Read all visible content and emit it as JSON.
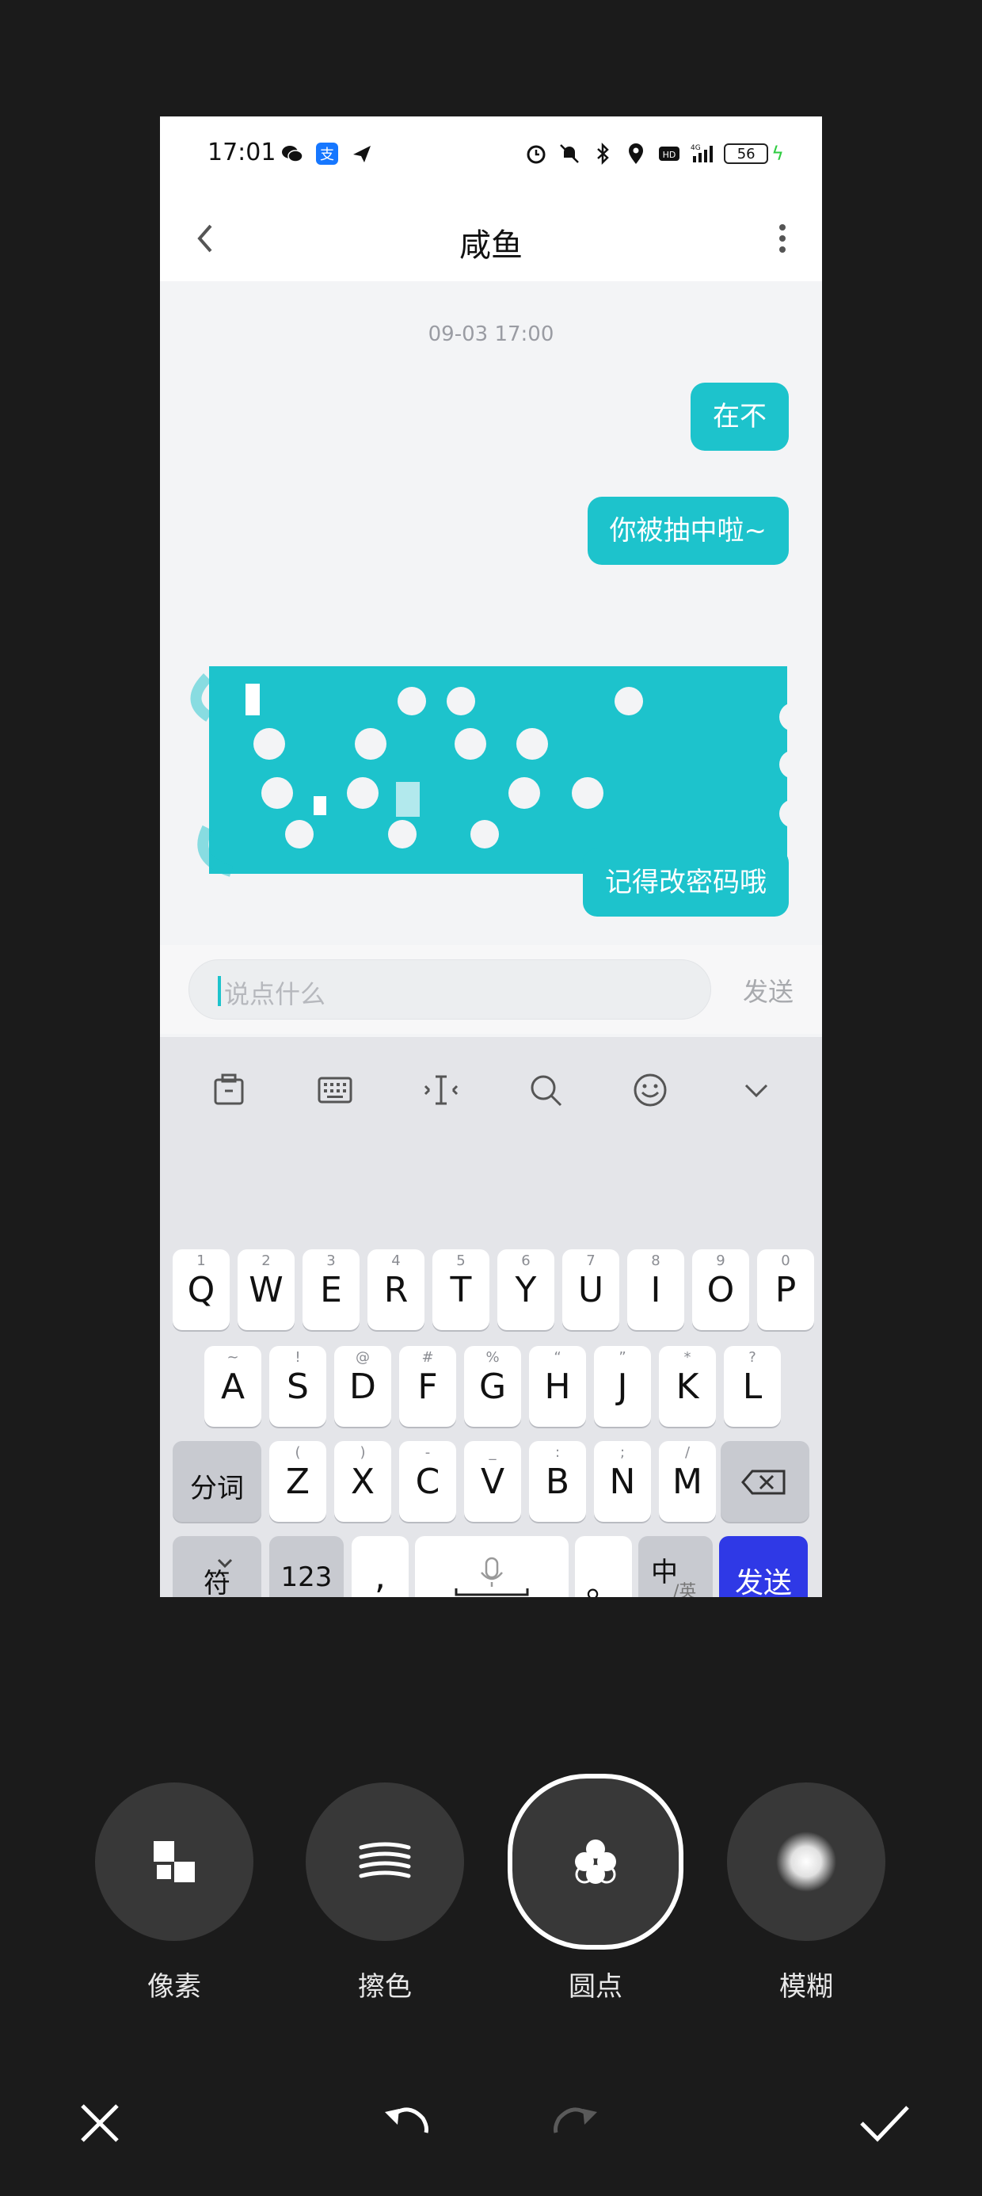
{
  "status_bar": {
    "time": "17:01",
    "network": "4G",
    "hd_label": "HD",
    "battery": "56"
  },
  "chat_header": {
    "title": "咸鱼"
  },
  "chat": {
    "timestamp": "09-03 17:00",
    "messages": [
      {
        "text": "在不"
      },
      {
        "text": "你被抽中啦~"
      },
      {
        "text": "记得改密码哦"
      }
    ],
    "input_placeholder": "说点什么",
    "send_label": "发送"
  },
  "keyboard": {
    "row1": [
      {
        "ch": "Q",
        "hint": "1"
      },
      {
        "ch": "W",
        "hint": "2"
      },
      {
        "ch": "E",
        "hint": "3"
      },
      {
        "ch": "R",
        "hint": "4"
      },
      {
        "ch": "T",
        "hint": "5"
      },
      {
        "ch": "Y",
        "hint": "6"
      },
      {
        "ch": "U",
        "hint": "7"
      },
      {
        "ch": "I",
        "hint": "8"
      },
      {
        "ch": "O",
        "hint": "9"
      },
      {
        "ch": "P",
        "hint": "0"
      }
    ],
    "row2": [
      {
        "ch": "A",
        "hint": "~"
      },
      {
        "ch": "S",
        "hint": "!"
      },
      {
        "ch": "D",
        "hint": "@"
      },
      {
        "ch": "F",
        "hint": "#"
      },
      {
        "ch": "G",
        "hint": "%"
      },
      {
        "ch": "H",
        "hint": "“"
      },
      {
        "ch": "J",
        "hint": "”"
      },
      {
        "ch": "K",
        "hint": "*"
      },
      {
        "ch": "L",
        "hint": "?"
      }
    ],
    "row3": [
      {
        "ch": "Z",
        "hint": "("
      },
      {
        "ch": "X",
        "hint": ")"
      },
      {
        "ch": "C",
        "hint": "-"
      },
      {
        "ch": "V",
        "hint": "_"
      },
      {
        "ch": "B",
        "hint": ":"
      },
      {
        "ch": "N",
        "hint": ";"
      },
      {
        "ch": "M",
        "hint": "/"
      }
    ],
    "fenci_label": "分词",
    "symbol_label": "符",
    "num_label": "123",
    "comma_label": ",",
    "period_label": "。",
    "lang_label": "中",
    "lang_sub": "/英",
    "send_label": "发送"
  },
  "editor": {
    "tools": [
      {
        "label": "像素",
        "icon": "pixel-icon"
      },
      {
        "label": "擦色",
        "icon": "smear-icon"
      },
      {
        "label": "圆点",
        "icon": "dots-icon"
      },
      {
        "label": "模糊",
        "icon": "blur-icon"
      }
    ],
    "selected_tool": "圆点",
    "accent": "#1dc3cc"
  }
}
